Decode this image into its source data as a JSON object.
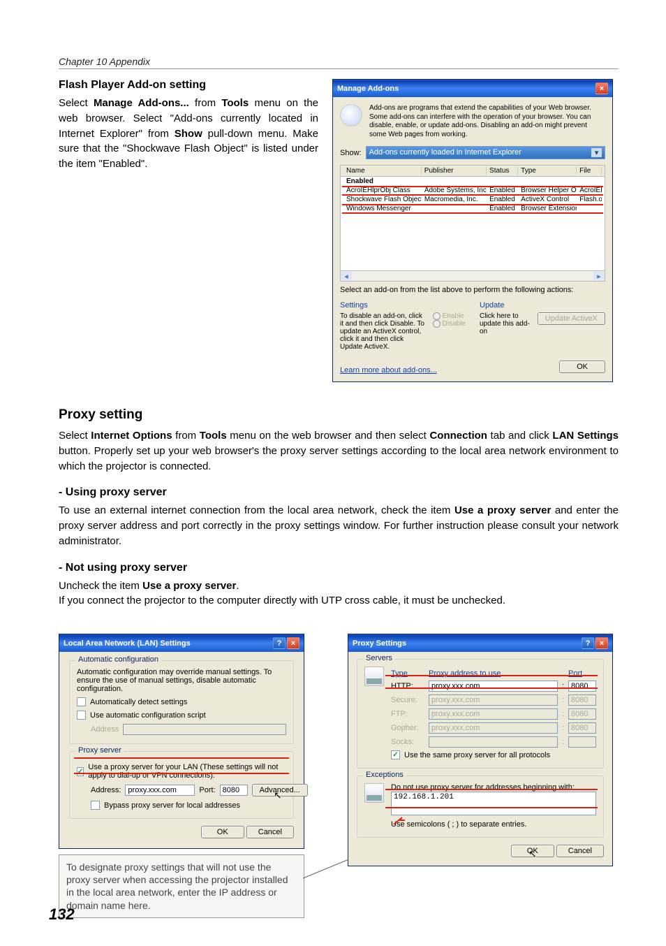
{
  "chapter": "Chapter 10 Appendix",
  "page_number": "132",
  "flash": {
    "title": "Flash Player Add-on setting",
    "p1a": "Select ",
    "p1b": "Manage Add-ons...",
    "p1c": " from ",
    "p1d": "Tools",
    "p1e": " menu on the web browser. Select \"Add-ons currently located in Internet Explorer\" from ",
    "p1f": "Show",
    "p1g": " pull-down menu. Make sure that the \"Shockwave Flash Object\" is listed under the item \"Enabled\"."
  },
  "manage_addons": {
    "title": "Manage Add-ons",
    "desc": "Add-ons are programs that extend the capabilities of your Web browser. Some add-ons can interfere with the operation of your browser. You can disable, enable, or update add-ons. Disabling an add-on might prevent some Web pages from working.",
    "show_label": "Show:",
    "show_value": "Add-ons currently loaded in Internet Explorer",
    "cols": {
      "name": "Name",
      "publisher": "Publisher",
      "status": "Status",
      "type": "Type",
      "file": "File"
    },
    "group_label": "Enabled",
    "rows": {
      "r1": {
        "name": "AcroIEHlprObj Class",
        "pub": "Adobe Systems, Incorpor...",
        "status": "Enabled",
        "type": "Browser Helper Object",
        "file": "AcroIEHe..."
      },
      "r2": {
        "name": "Shockwave Flash Object",
        "pub": "Macromedia, Inc.",
        "status": "Enabled",
        "type": "ActiveX Control",
        "file": "Flash.ocx"
      },
      "r3": {
        "name": "Windows Messenger",
        "pub": "",
        "status": "Enabled",
        "type": "Browser Extension",
        "file": ""
      }
    },
    "instruction": "Select an add-on from the list above to perform the following actions:",
    "settings_label": "Settings",
    "settings_text": "To disable an add-on, click it and then click Disable. To update an ActiveX control, click it and then click Update ActiveX.",
    "enable": "Enable",
    "disable": "Disable",
    "update_label": "Update",
    "update_text": "Click here to update this add-on",
    "update_btn": "Update ActiveX",
    "learn": "Learn more about add-ons...",
    "ok": "OK"
  },
  "proxy": {
    "title": "Proxy setting",
    "p1a": "Select ",
    "p1b": "Internet Options",
    "p1c": " from ",
    "p1d": "Tools",
    "p1e": " menu on the web browser and then select ",
    "p1f": "Connection",
    "p1g": " tab and click ",
    "p1h": "LAN Settings",
    "p1i": " button. Properly set up your web browser's the proxy server settings according to the local area network environment to which the projector is connected.",
    "using_title": "- Using proxy server",
    "using_text_a": "To use an external internet connection from the local area network, check the item ",
    "using_text_b": "Use a proxy server",
    "using_text_c": " and enter the proxy server address and port correctly in the proxy settings window. For further instruction please consult your network administrator.",
    "notusing_title": "- Not using proxy server",
    "notusing_text_a": "Uncheck the item ",
    "notusing_text_b": "Use a proxy server",
    "notusing_text_c": ".",
    "notusing_text2": "If you connect the projector to the computer directly with UTP cross cable, it must be unchecked."
  },
  "lan": {
    "title": "Local Area Network (LAN) Settings",
    "auto_label": "Automatic configuration",
    "auto_text": "Automatic configuration may override manual settings.  To ensure the use of manual settings, disable automatic configuration.",
    "auto_detect": "Automatically detect settings",
    "auto_script": "Use automatic configuration script",
    "address_label": "Address",
    "proxy_label": "Proxy server",
    "use_proxy": "Use a proxy server for your LAN (These settings will not apply to dial-up or VPN connections).",
    "address": "Address:",
    "address_val": "proxy.xxx.com",
    "port": "Port:",
    "port_val": "8080",
    "advanced": "Advanced...",
    "bypass": "Bypass proxy server for local addresses",
    "ok": "OK",
    "cancel": "Cancel"
  },
  "ps": {
    "title": "Proxy Settings",
    "servers": "Servers",
    "type": "Type",
    "addr": "Proxy address to use",
    "port": "Port",
    "http": "HTTP:",
    "secure": "Secure:",
    "ftp": "FTP:",
    "gopher": "Gopher:",
    "socks": "Socks:",
    "val": "proxy.xxx.com",
    "p8080": "8080",
    "same": "Use the same proxy server for all protocols",
    "exceptions": "Exceptions",
    "except_text": "Do not use proxy server for addresses beginning with:",
    "except_val": "192.168.1.201",
    "semi": "Use semicolons ( ; ) to separate entries.",
    "ok": "OK",
    "cancel": "Cancel"
  },
  "annotation": "To designate proxy settings that will not use the proxy server when accessing the projector installed in the local area network, enter the IP address or domain name here."
}
